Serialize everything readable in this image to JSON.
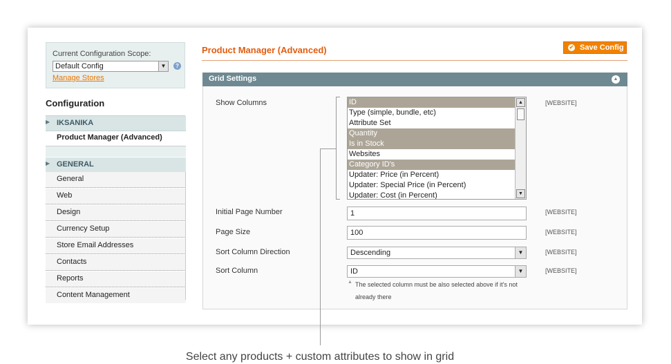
{
  "scope": {
    "label": "Current Configuration Scope:",
    "selected": "Default Config",
    "manage_link": "Manage Stores"
  },
  "sidebar": {
    "title": "Configuration",
    "sections": [
      {
        "label": "IKSANIKA",
        "active_item": "Product Manager (Advanced)"
      },
      {
        "label": "GENERAL"
      }
    ],
    "items": [
      "General",
      "Web",
      "Design",
      "Currency Setup",
      "Store Email Addresses",
      "Contacts",
      "Reports",
      "Content Management"
    ]
  },
  "main": {
    "title": "Product Manager (Advanced)",
    "save_label": "Save Config",
    "grid_title": "Grid Settings",
    "scope_tag": "[WEBSITE]",
    "fields": {
      "show_columns": {
        "label": "Show Columns",
        "options": [
          {
            "text": "ID",
            "selected": true
          },
          {
            "text": "Type (simple, bundle, etc)",
            "selected": false
          },
          {
            "text": "Attribute Set",
            "selected": false
          },
          {
            "text": "Quantity",
            "selected": true
          },
          {
            "text": "Is in Stock",
            "selected": true
          },
          {
            "text": "Websites",
            "selected": false
          },
          {
            "text": "Category ID's",
            "selected": true
          },
          {
            "text": "Updater: Price (in Percent)",
            "selected": false
          },
          {
            "text": "Updater: Special Price (in Percent)",
            "selected": false
          },
          {
            "text": "Updater: Cost (in Percent)",
            "selected": false
          }
        ]
      },
      "initial_page": {
        "label": "Initial Page Number",
        "value": "1"
      },
      "page_size": {
        "label": "Page Size",
        "value": "100"
      },
      "sort_direction": {
        "label": "Sort Column Direction",
        "value": "Descending"
      },
      "sort_column": {
        "label": "Sort Column",
        "value": "ID",
        "note": "The selected column must be also selected above if it's not already there"
      }
    }
  },
  "caption": "Select any products + custom attributes to show in grid",
  "colors": {
    "accent": "#e25d0e",
    "button": "#f18200",
    "header_bar": "#6f8992",
    "selected_option": "#aca597"
  }
}
